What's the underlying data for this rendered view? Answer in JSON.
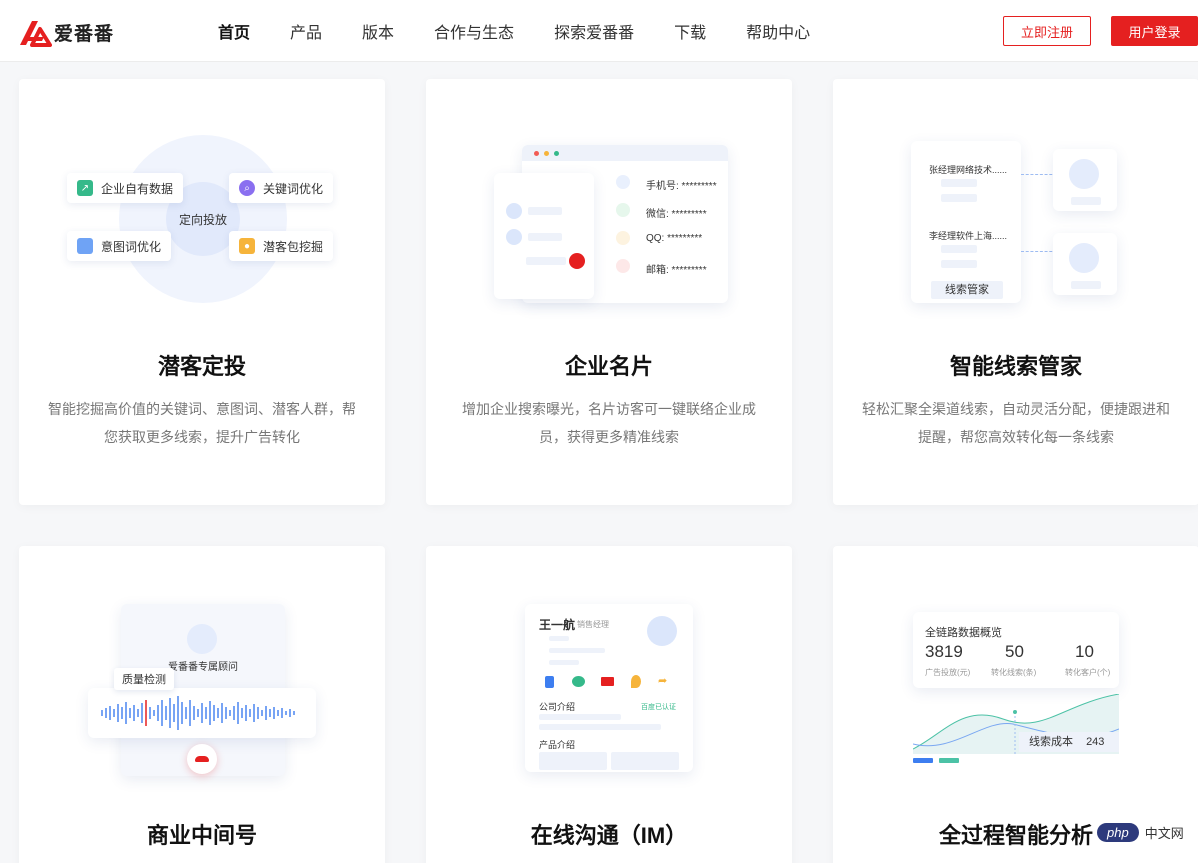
{
  "brand": {
    "name": "爱番番",
    "color": "#e52020"
  },
  "nav": {
    "items": [
      "首页",
      "产品",
      "版本",
      "合作与生态",
      "探索爱番番",
      "下载",
      "帮助中心"
    ],
    "active_index": 0
  },
  "header": {
    "register_label": "立即注册",
    "login_label": "用户登录"
  },
  "cards": [
    {
      "title": "潜客定投",
      "desc_lines": [
        "智能挖掘高价值的关键词、意图词、潜客人群，帮",
        "您获取更多线索，提升广告转化"
      ],
      "illus": {
        "center": "定向投放",
        "pills": [
          "企业自有数据",
          "关键词优化",
          "意图词优化",
          "潜客包挖掘"
        ]
      }
    },
    {
      "title": "企业名片",
      "desc_lines": [
        "增加企业搜索曝光，名片访客可一键联络企业成",
        "员，获得更多精准线索"
      ],
      "illus": {
        "fields": [
          "手机号: *********",
          "微信: *********",
          "QQ: *********",
          "邮箱: *********"
        ]
      }
    },
    {
      "title": "智能线索管家",
      "desc_lines": [
        "轻松汇聚全渠道线索，自动灵活分配，便捷跟进和",
        "提醒，帮您高效转化每一条线索"
      ],
      "illus": {
        "lead1": "张经理网络技术......",
        "lead2": "李经理软件上海......",
        "footer": "线索管家"
      }
    },
    {
      "title": "商业中间号",
      "illus": {
        "consultant": "爱番番专属顾问",
        "tag": "质量检测"
      }
    },
    {
      "title": "在线沟通（IM）",
      "illus": {
        "name": "王一航",
        "role": "销售经理",
        "company_section": "公司介绍",
        "verified": "百度已认证",
        "product_section": "产品介绍"
      }
    },
    {
      "title": "全过程智能分析",
      "illus": {
        "panel_title": "全链路数据概览",
        "stats": [
          {
            "value": "3819",
            "label": "广告投放(元)"
          },
          {
            "value": "50",
            "label": "转化线索(条)"
          },
          {
            "value": "10",
            "label": "转化客户(个)"
          }
        ],
        "tooltip_label": "线索成本",
        "tooltip_value": "243"
      }
    }
  ],
  "watermark": {
    "logo": "php",
    "text": "中文网"
  }
}
